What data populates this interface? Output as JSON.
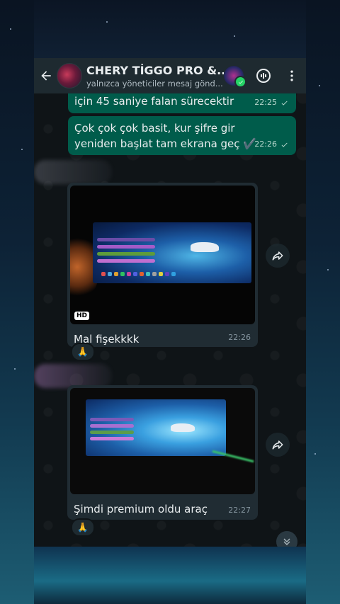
{
  "header": {
    "title": "CHERY TİGGO PRO &...",
    "subtitle": "yalnızca yöneticiler mesaj gönd..."
  },
  "messages": [
    {
      "text": "için 45 saniye falan sürecektir",
      "time": "22:25"
    },
    {
      "text": "Çok çok çok basit, kur şifre gir yeniden başlat tam ekrana geç ✔️",
      "time": "22:26"
    }
  ],
  "media_messages": [
    {
      "badge": "HD",
      "caption": "Mal fişekkkk",
      "time": "22:26",
      "reaction": "🙏"
    },
    {
      "caption": "Şimdi premium oldu araç",
      "time": "22:27",
      "reaction": "🙏"
    }
  ],
  "colors": {
    "header_bg": "#1e2a30",
    "outgoing_bubble": "#005c4b",
    "incoming_bubble": "#202c33",
    "verified_badge": "#25d366"
  }
}
